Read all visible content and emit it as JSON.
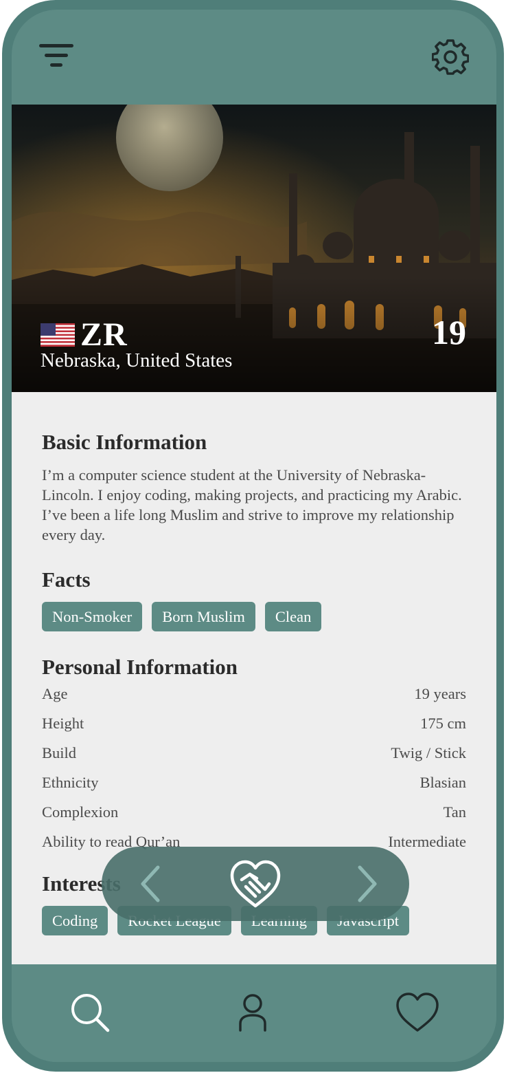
{
  "topbar": {
    "menu_icon": "filter-menu-icon",
    "settings_icon": "gear-icon"
  },
  "profile": {
    "flag": "us-flag-icon",
    "name": "ZR",
    "age": "19",
    "location": "Nebraska, United States"
  },
  "basic": {
    "title": "Basic Information",
    "bio": "I’m a computer science student at the University of Nebraska-Lincoln. I enjoy coding, making projects, and practicing my Arabic. I’ve been a life long Muslim and strive to improve my relationship every day."
  },
  "facts": {
    "title": "Facts",
    "chips": [
      "Non-Smoker",
      "Born Muslim",
      "Clean"
    ]
  },
  "personal": {
    "title": "Personal Information",
    "rows": [
      {
        "label": "Age",
        "value": "19 years"
      },
      {
        "label": "Height",
        "value": "175 cm"
      },
      {
        "label": "Build",
        "value": "Twig / Stick"
      },
      {
        "label": "Ethnicity",
        "value": "Blasian"
      },
      {
        "label": "Complexion",
        "value": "Tan"
      },
      {
        "label": "Ability to read Qur’an",
        "value": "Intermediate"
      }
    ]
  },
  "interests": {
    "title": "Interests",
    "chips": [
      "Coding",
      "Rocket League",
      "Learning",
      "Javascript"
    ]
  },
  "actions": {
    "prev_icon": "chevron-left-icon",
    "match_icon": "handshake-heart-icon",
    "next_icon": "chevron-right-icon"
  },
  "nav": {
    "items": [
      "search-icon",
      "user-icon",
      "heart-icon"
    ]
  },
  "colors": {
    "primary": "#5d8b85",
    "frame": "#4f7e79",
    "content_bg": "#eeeeee",
    "text": "#2b2b2b"
  }
}
